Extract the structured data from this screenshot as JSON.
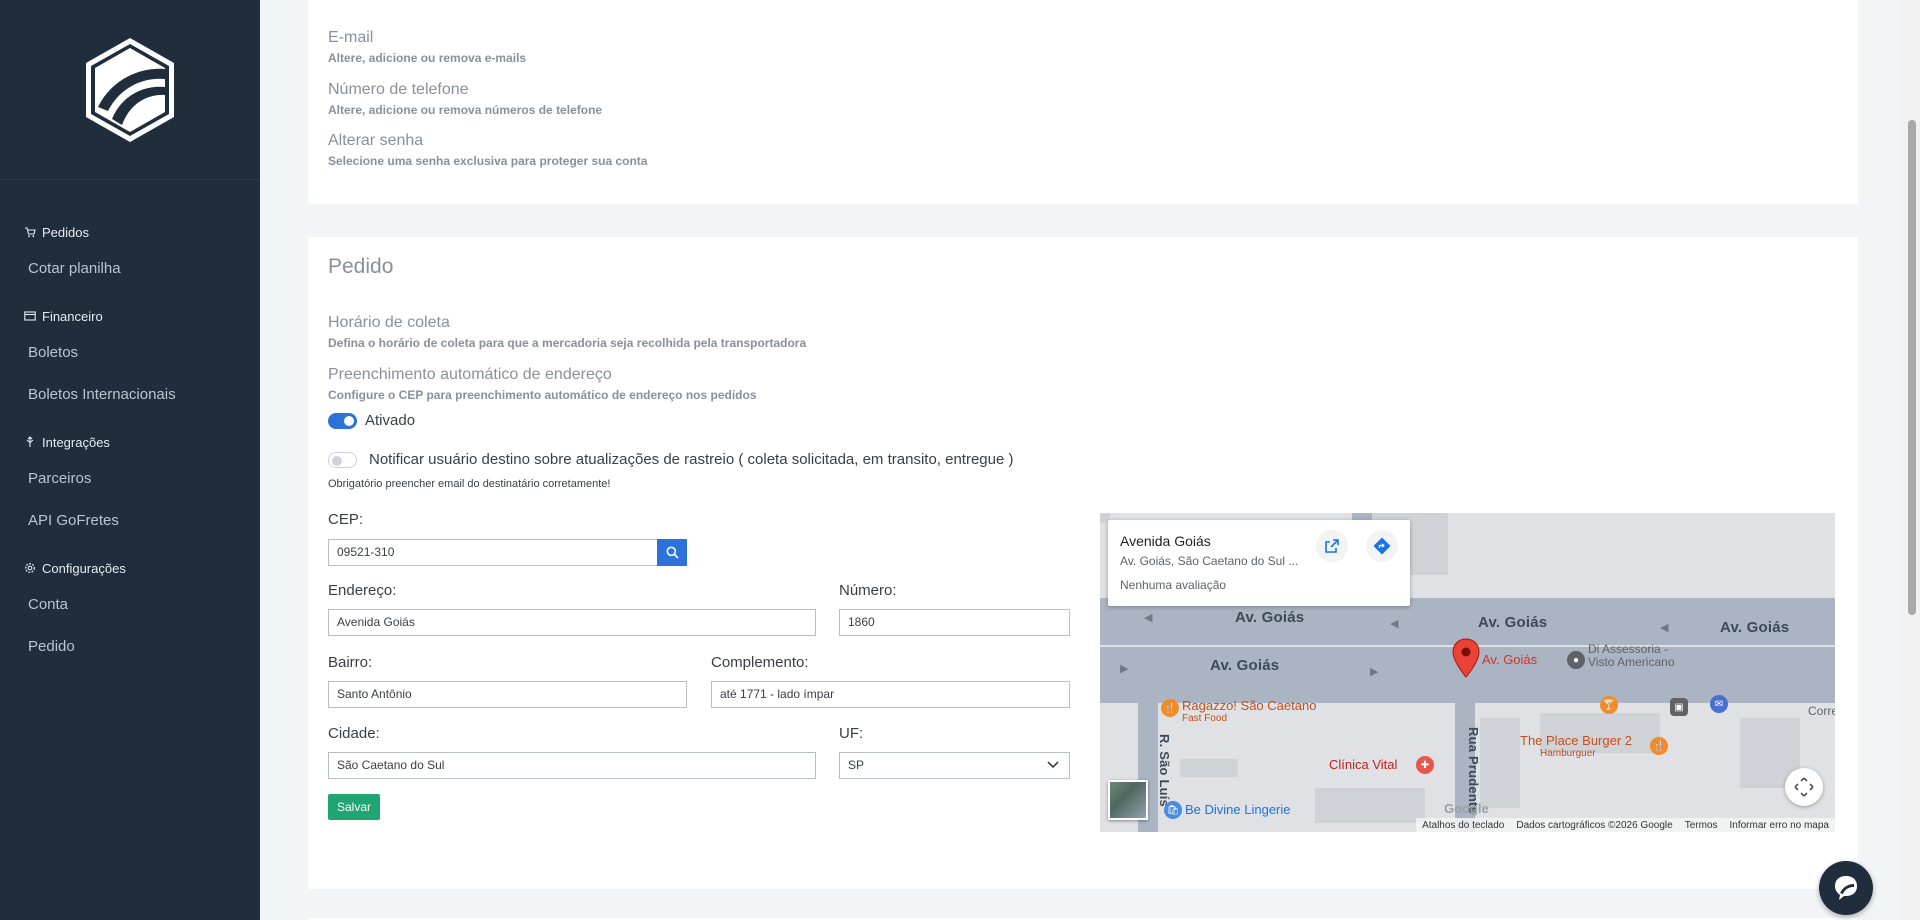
{
  "sidebar": {
    "sections": [
      {
        "label": "Pedidos",
        "icon": "cart-icon",
        "items": [
          "Cotar planilha"
        ]
      },
      {
        "label": "Financeiro",
        "icon": "card-icon",
        "items": [
          "Boletos",
          "Boletos Internacionais"
        ]
      },
      {
        "label": "Integrações",
        "icon": "plug-icon",
        "items": [
          "Parceiros",
          "API GoFretes"
        ]
      },
      {
        "label": "Configurações",
        "icon": "gear-icon",
        "items": [
          "Conta",
          "Pedido"
        ]
      }
    ]
  },
  "account": {
    "email": {
      "title": "E-mail",
      "desc": "Altere, adicione ou remova e-mails"
    },
    "phone": {
      "title": "Número de telefone",
      "desc": "Altere, adicione ou remova números de telefone"
    },
    "password": {
      "title": "Alterar senha",
      "desc": "Selecione uma senha exclusiva para proteger sua conta"
    }
  },
  "pedido": {
    "title": "Pedido",
    "pickup": {
      "title": "Horário de coleta",
      "desc": "Defina o horário de coleta para que a mercadoria seja recolhida pela transportadora"
    },
    "autofill": {
      "title": "Preenchimento automático de endereço",
      "desc": "Configure o CEP para preenchimento automático de endereço nos pedidos"
    },
    "toggle_autofill": {
      "label": "Ativado",
      "on": true
    },
    "toggle_notify": {
      "label": "Notificar usuário destino sobre atualizações de rastreio ( coleta solicitada, em transito, entregue )",
      "on": false
    },
    "hint": "Obrigatório preencher email do destinatário corretamente!",
    "form": {
      "cep_label": "CEP:",
      "cep_value": "09521-310",
      "endereco_label": "Endereço:",
      "endereco_value": "Avenida Goiás",
      "numero_label": "Número:",
      "numero_value": "1860",
      "bairro_label": "Bairro:",
      "bairro_value": "Santo Antônio",
      "complemento_label": "Complemento:",
      "complemento_value": "até 1771 - lado ímpar",
      "cidade_label": "Cidade:",
      "cidade_value": "São Caetano do Sul",
      "uf_label": "UF:",
      "uf_value": "SP",
      "save_label": "Salvar"
    }
  },
  "map": {
    "card_title": "Avenida Goiás",
    "card_address": "Av. Goiás, São Caetano do Sul ...",
    "card_rating": "Nenhuma avaliação",
    "street_labels": [
      "Av. Goiás",
      "Av. Goiás",
      "Av. Goiás",
      "Av. Goiás",
      "R. São Luís",
      "Rua Prudente"
    ],
    "marker_label": "Av. Goiás",
    "pois": {
      "assessoria": "Di Assessoria -\nVisto Americano",
      "ragazzo": "Ragazzo! São Caetano",
      "ragazzo_sub": "Fast Food",
      "clinica": "Clínica Vital",
      "burger": "The Place Burger 2",
      "burger_sub": "Hamburguer",
      "lingerie": "Be Divine Lingerie",
      "corre": "Corre"
    },
    "google": "Google",
    "footer": [
      "Atalhos do teclado",
      "Dados cartográficos ©2026 Google",
      "Termos",
      "Informar erro no mapa"
    ]
  },
  "colors": {
    "sidebar": "#1f2d3d",
    "primary": "#2d72d9",
    "save": "#1fa672"
  }
}
